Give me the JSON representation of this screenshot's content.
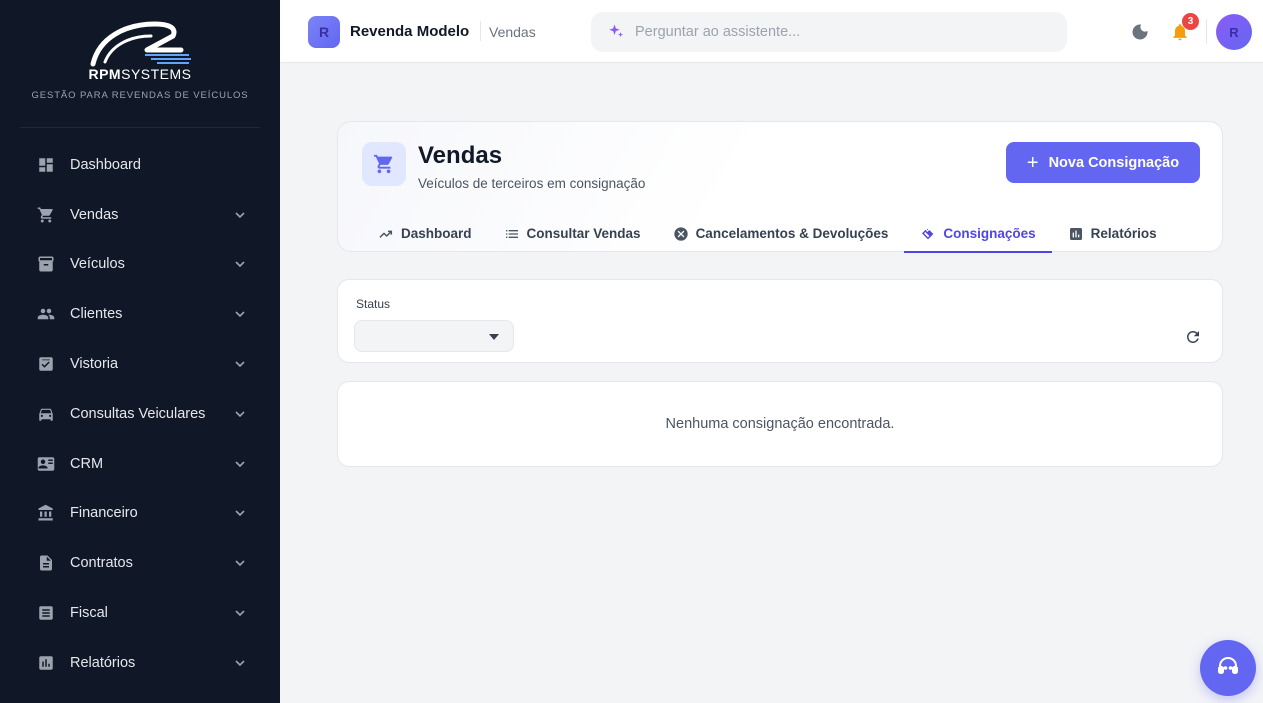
{
  "brand": {
    "logo_text_bold": "RPM",
    "logo_text_light": "SYSTEMS",
    "tagline": "GESTÃO PARA REVENDAS DE VEÍCULOS"
  },
  "sidebar": {
    "items": [
      {
        "label": "Dashboard",
        "icon": "dashboard-icon",
        "has_submenu": false
      },
      {
        "label": "Vendas",
        "icon": "cart-icon",
        "has_submenu": true
      },
      {
        "label": "Veículos",
        "icon": "archive-icon",
        "has_submenu": true
      },
      {
        "label": "Clientes",
        "icon": "people-icon",
        "has_submenu": true
      },
      {
        "label": "Vistoria",
        "icon": "checklist-icon",
        "has_submenu": true
      },
      {
        "label": "Consultas Veiculares",
        "icon": "car-icon",
        "has_submenu": true
      },
      {
        "label": "CRM",
        "icon": "contact-card-icon",
        "has_submenu": true
      },
      {
        "label": "Financeiro",
        "icon": "bank-icon",
        "has_submenu": true
      },
      {
        "label": "Contratos",
        "icon": "document-icon",
        "has_submenu": true
      },
      {
        "label": "Fiscal",
        "icon": "receipt-icon",
        "has_submenu": true
      },
      {
        "label": "Relatórios",
        "icon": "bar-chart-icon",
        "has_submenu": true
      }
    ]
  },
  "topbar": {
    "store_initial": "R",
    "store_name": "Revenda Modelo",
    "breadcrumb": "Vendas",
    "assistant_placeholder": "Perguntar ao assistente...",
    "notification_count": "3",
    "user_initial": "R"
  },
  "page": {
    "title": "Vendas",
    "subtitle": "Veículos de terceiros em consignação",
    "new_button_label": "Nova Consignação",
    "tabs": [
      {
        "label": "Dashboard",
        "icon": "trending-up-icon",
        "active": false
      },
      {
        "label": "Consultar Vendas",
        "icon": "list-icon",
        "active": false
      },
      {
        "label": "Cancelamentos & Devoluções",
        "icon": "cancel-icon",
        "active": false
      },
      {
        "label": "Consignações",
        "icon": "handshake-icon",
        "active": true
      },
      {
        "label": "Relatórios",
        "icon": "report-icon",
        "active": false
      }
    ]
  },
  "filters": {
    "status_label": "Status",
    "status_value": ""
  },
  "empty_state": {
    "message": "Nenhuma consignação encontrada."
  },
  "colors": {
    "sidebar_bg": "#101827",
    "accent": "#6366f1",
    "badge": "#ef4444",
    "bell": "#f59e0b"
  }
}
